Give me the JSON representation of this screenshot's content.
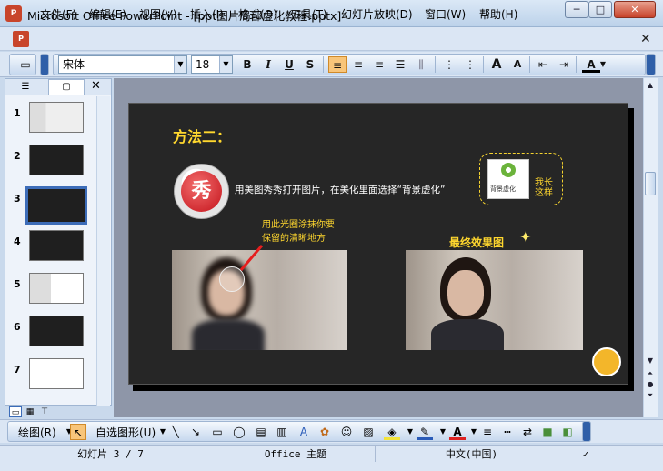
{
  "window": {
    "title": "Microsoft Office PowerPoint - [ppt图片局部虚化教程.pptx]",
    "app_icon": "P",
    "min": "─",
    "max": "□",
    "close": "✕"
  },
  "menu": {
    "items": [
      "文件(F)",
      "编辑(E)",
      "视图(V)",
      "插入(I)",
      "格式(O)",
      "工具(T)",
      "幻灯片放映(D)",
      "窗口(W)",
      "帮助(H)"
    ],
    "close": "✕"
  },
  "toolbar": {
    "font_name": "宋体",
    "font_size": "18",
    "bold": "B",
    "italic": "I",
    "underline": "U",
    "shadow": "S",
    "grow_font": "A",
    "shrink_font": "A",
    "font_color": "A"
  },
  "slides_panel": {
    "tab_outline_icon": "outline-icon",
    "tab_slides_icon": "slides-icon",
    "close": "✕",
    "thumbnails": [
      {
        "num": "1"
      },
      {
        "num": "2"
      },
      {
        "num": "3",
        "selected": true
      },
      {
        "num": "4"
      },
      {
        "num": "5"
      },
      {
        "num": "6"
      },
      {
        "num": "7"
      }
    ]
  },
  "slide": {
    "title": "方法二：",
    "logo_char": "秀",
    "instruction": "用美图秀秀打开图片，在美化里面选择“背景虚化”",
    "callout_icon_label": "背景虚化",
    "callout_text": "我长这样",
    "note_line1": "用此光圈涂抹你要",
    "note_line2": "保留的清晰地方",
    "result_title": "最终效果图",
    "sparkle": "✦"
  },
  "drawbar": {
    "draw_label": "绘图(R)",
    "autoshapes_label": "自选图形(U)"
  },
  "status": {
    "slide_info": "幻灯片 3 / 7",
    "theme": "Office 主题",
    "language": "中文(中国)"
  },
  "colors": {
    "accent_yellow": "#ffd72e",
    "slide_bg": "#262626",
    "selection_blue": "#3c6cb8"
  }
}
